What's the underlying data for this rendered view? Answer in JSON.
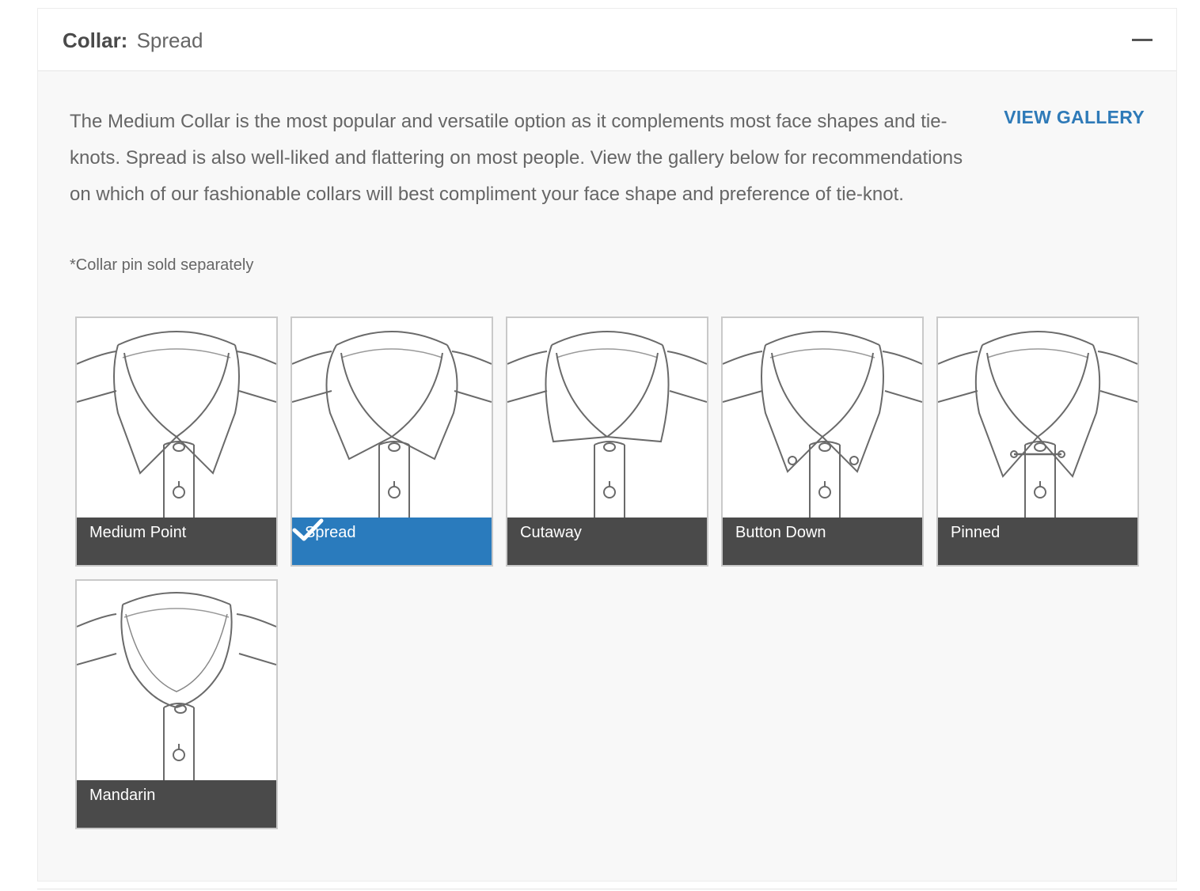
{
  "header": {
    "label": "Collar:",
    "value": "Spread",
    "toggle_icon": "minus-icon"
  },
  "description": "The Medium Collar is the most popular and versatile option as it complements most face shapes and tie-knots. Spread is also well-liked and flattering on most people. View the gallery below for recommendations on which of our fashionable collars will best compliment your face shape and preference of tie-knot.",
  "view_gallery_label": "VIEW GALLERY",
  "note": "*Collar pin sold separately",
  "options": [
    {
      "label": "Medium Point",
      "selected": false
    },
    {
      "label": "Spread",
      "selected": true
    },
    {
      "label": "Cutaway",
      "selected": false
    },
    {
      "label": "Button Down",
      "selected": false
    },
    {
      "label": "Pinned",
      "selected": false
    },
    {
      "label": "Mandarin",
      "selected": false
    }
  ],
  "colors": {
    "accent": "#2e7ab8",
    "selected_caption": "#2a7bbd",
    "caption": "#4a4a4a"
  }
}
